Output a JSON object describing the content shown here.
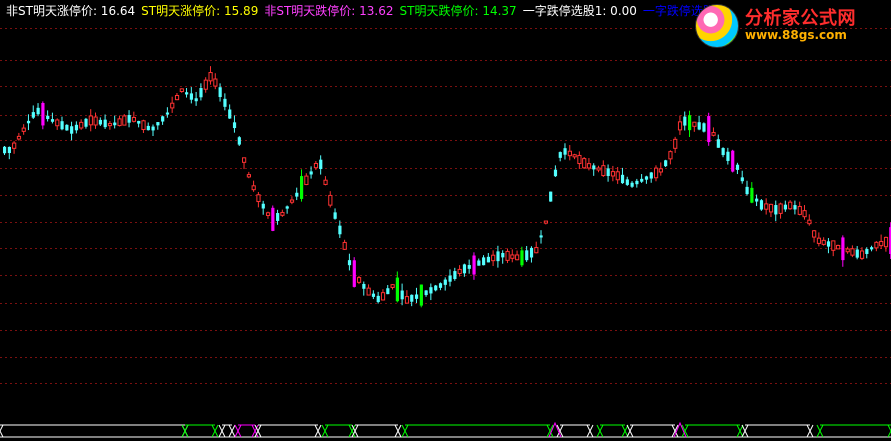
{
  "header": {
    "items": [
      {
        "label": "非ST明天涨停价: 16.64",
        "color": "#ffffff"
      },
      {
        "label": "ST明天涨停价: 15.89",
        "color": "#ffff00"
      },
      {
        "label": "非ST明天跌停价: 13.62",
        "color": "#ff40ff"
      },
      {
        "label": "ST明天跌停价: 14.37",
        "color": "#00ff00"
      },
      {
        "label": "一字跌停选股1: 0.00",
        "color": "#ffffff"
      },
      {
        "label": "一字跌停选股",
        "color": "#0000ff"
      }
    ]
  },
  "logo": {
    "brand": "分析家公式网",
    "url": "www.88gs.com"
  },
  "chart_data": {
    "type": "candlestick",
    "bars": 186,
    "ylim": [
      11.5,
      17.5
    ],
    "grid": "horizontal dashed red",
    "colors": {
      "up": "#ff3232",
      "down": "#54ffff",
      "limit_up": "#ff00ff",
      "limit_down": "#00ff00"
    }
  }
}
